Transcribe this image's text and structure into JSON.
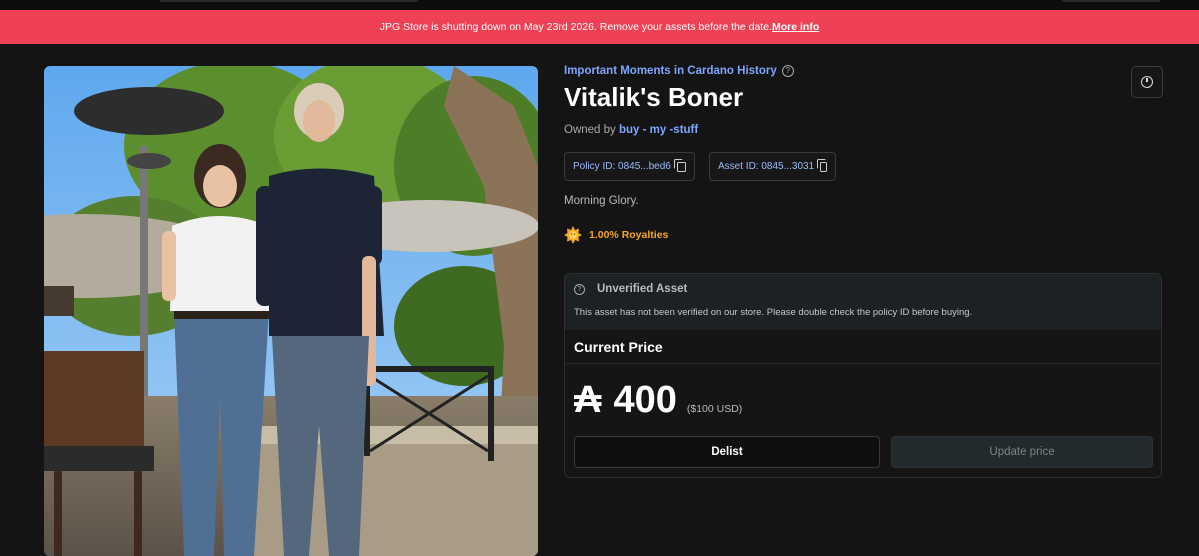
{
  "banner": {
    "message": "JPG Store is shutting down on May 23rd 2026. Remove your assets before the date.",
    "link": "More info"
  },
  "asset": {
    "collection": "Important Moments in Cardano History",
    "title": "Vitalik's Boner",
    "owned_by_label": "Owned by",
    "owner": "buy - my -stuff",
    "policy_id": "Policy ID: 0845...bed6",
    "asset_id": "Asset ID: 0845...3031",
    "description": "Morning Glory.",
    "royalties": "1.00% Royalties"
  },
  "warning": {
    "title": "Unverified Asset",
    "text": "This asset has not been verified on our store. Please double check the policy ID before buying."
  },
  "pricing": {
    "header": "Current Price",
    "currency_symbol": "₳",
    "price": "400",
    "usd": "($100 USD)",
    "delist_label": "Delist",
    "update_label": "Update price"
  },
  "colors": {
    "banner_bg": "#ef4156",
    "accent_link": "#7fa6ff",
    "royalty": "#f5a623",
    "background": "#141414"
  },
  "icons": {
    "info": "info-icon",
    "copy": "copy-icon",
    "history": "clock-icon",
    "royalty": "sun-badge-icon"
  }
}
